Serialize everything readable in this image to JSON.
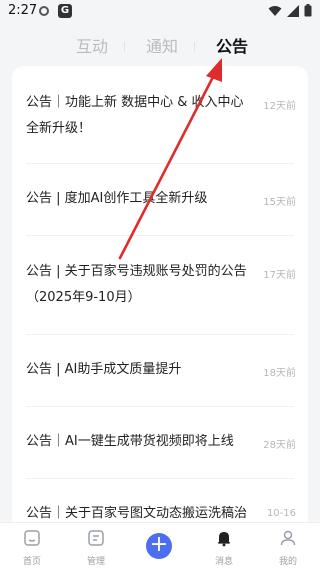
{
  "status_bar": {
    "time": "2:27",
    "notif_badge": "G"
  },
  "tabs": [
    {
      "label": "互动"
    },
    {
      "label": "通知"
    },
    {
      "label": "公告"
    }
  ],
  "announcements": [
    {
      "title": "公告｜功能上新 数据中心 & 收入中心全新升级！",
      "time": "12天前"
    },
    {
      "title": "公告 | 度加AI创作工具全新升级",
      "time": "15天前"
    },
    {
      "title": "公告 | 关于百家号违规账号处罚的公告（2025年9-10月）",
      "time": "17天前"
    },
    {
      "title": "公告 | AI助手成文质量提升",
      "time": "18天前"
    },
    {
      "title": "公告｜AI一键生成带货视频即将上线",
      "time": "28天前"
    },
    {
      "title": "公告｜关于百家号图文动态搬运洗稿治",
      "time": "10-16"
    }
  ],
  "bottom_nav": [
    {
      "label": "首页",
      "icon": "home-icon"
    },
    {
      "label": "管理",
      "icon": "manage-icon"
    },
    {
      "label": "",
      "icon": "plus-icon"
    },
    {
      "label": "消息",
      "icon": "bell-icon"
    },
    {
      "label": "我的",
      "icon": "person-icon"
    }
  ],
  "colors": {
    "accent": "#4e6ef2",
    "arrow": "#e02b2b",
    "background": "#f4f5f7"
  }
}
